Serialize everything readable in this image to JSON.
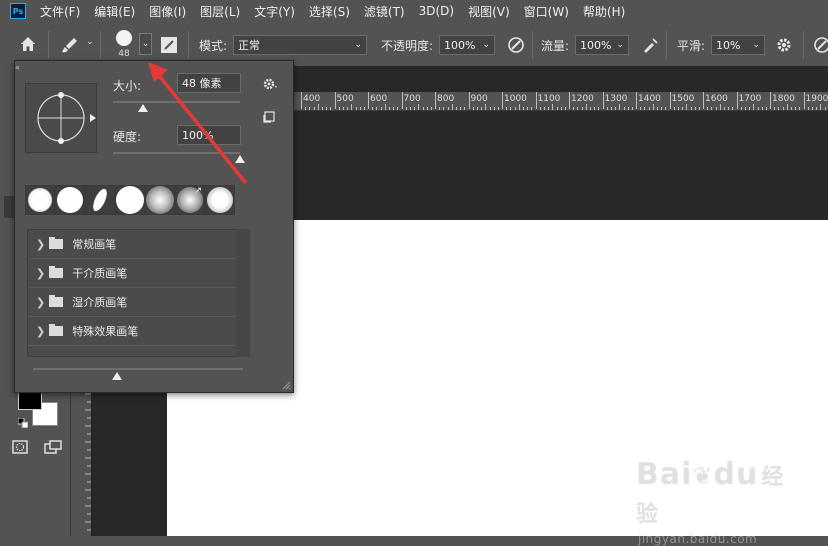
{
  "menubar": {
    "logo": "Ps",
    "items": [
      "文件(F)",
      "编辑(E)",
      "图像(I)",
      "图层(L)",
      "文字(Y)",
      "选择(S)",
      "滤镜(T)",
      "3D(D)",
      "视图(V)",
      "窗口(W)",
      "帮助(H)"
    ]
  },
  "options": {
    "brush_size_badge": "48",
    "mode_label": "模式:",
    "mode_value": "正常",
    "opacity_label": "不透明度:",
    "opacity_value": "100%",
    "flow_label": "流量:",
    "flow_value": "100%",
    "smooth_label": "平滑:",
    "smooth_value": "10%"
  },
  "brush_panel": {
    "size_label": "大小:",
    "size_value": "48 像素",
    "size_slider": 0.24,
    "hardness_label": "硬度:",
    "hardness_value": "100%",
    "hardness_slider": 1.0,
    "folders": [
      "常规画笔",
      "干介质画笔",
      "湿介质画笔",
      "特殊效果画笔"
    ],
    "thumbnail_slider": 0.4
  },
  "ruler": {
    "ticks": [
      "400",
      "500",
      "600",
      "700",
      "800",
      "900",
      "1000",
      "1100",
      "1200",
      "1300",
      "1400",
      "1500",
      "1600",
      "1700",
      "1800",
      "1900"
    ]
  },
  "annotation": {
    "arrow_color": "#e53935"
  },
  "watermark": {
    "brand": "Bai",
    "brand2": "du",
    "product": "经验",
    "url": "jingyan.baidu.com"
  }
}
